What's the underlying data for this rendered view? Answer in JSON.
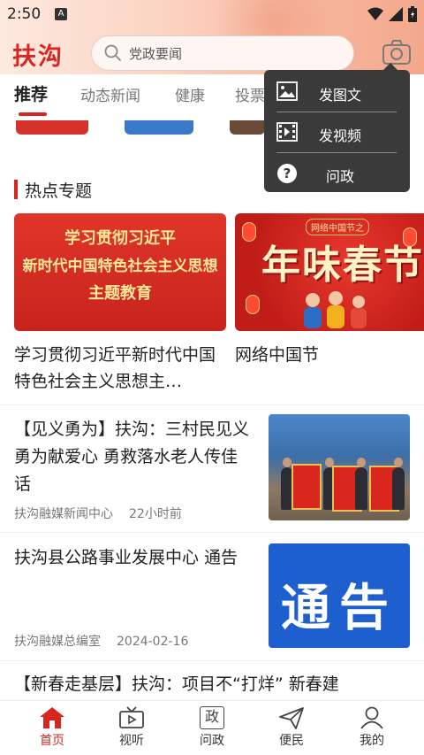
{
  "status_bar": {
    "time": "2:50",
    "notification_letter": "A"
  },
  "header": {
    "logo_text": "扶沟",
    "search_placeholder": "党政要闻"
  },
  "tabs": [
    {
      "label": "推荐",
      "active": true
    },
    {
      "label": "动态新闻",
      "active": false
    },
    {
      "label": "健康",
      "active": false
    },
    {
      "label": "投票",
      "active": false
    }
  ],
  "popup_menu": [
    {
      "label": "发图文",
      "icon": "image-icon"
    },
    {
      "label": "发视频",
      "icon": "video-icon"
    },
    {
      "label": "问政",
      "icon": "question-icon"
    }
  ],
  "hot_topics": {
    "section_title": "热点专题",
    "items": [
      {
        "image_lines": [
          "学习贯彻习近平",
          "新时代中国特色社会主义思想",
          "主题教育"
        ],
        "caption": "学习贯彻习近平新时代中国特色社会主义思想主…"
      },
      {
        "image_badge": "网络中国节之",
        "image_big_text": "年味春节",
        "caption": "网络中国节"
      }
    ]
  },
  "news": [
    {
      "title": "【见义勇为】扶沟：三村民见义勇为献爱心 勇救落水老人传佳话",
      "source": "扶沟融媒新闻中心",
      "time": "22小时前",
      "thumb": "photo"
    },
    {
      "title": "扶沟县公路事业发展中心 通告",
      "source": "扶沟融媒总编室",
      "time": "2024-02-16",
      "thumb_text": "通告"
    },
    {
      "title": "【新春走基层】扶沟：项目不“打烊” 新春建"
    }
  ],
  "bottom_nav": [
    {
      "label": "首页",
      "icon": "home-icon",
      "active": true
    },
    {
      "label": "视听",
      "icon": "tv-icon",
      "active": false
    },
    {
      "label": "问政",
      "icon": "zheng-icon",
      "active": false,
      "icon_char": "政"
    },
    {
      "label": "便民",
      "icon": "send-icon",
      "active": false
    },
    {
      "label": "我的",
      "icon": "person-icon",
      "active": false
    }
  ],
  "colors": {
    "brand_red": "#d7261f",
    "popup_bg": "#3a3a3a"
  }
}
